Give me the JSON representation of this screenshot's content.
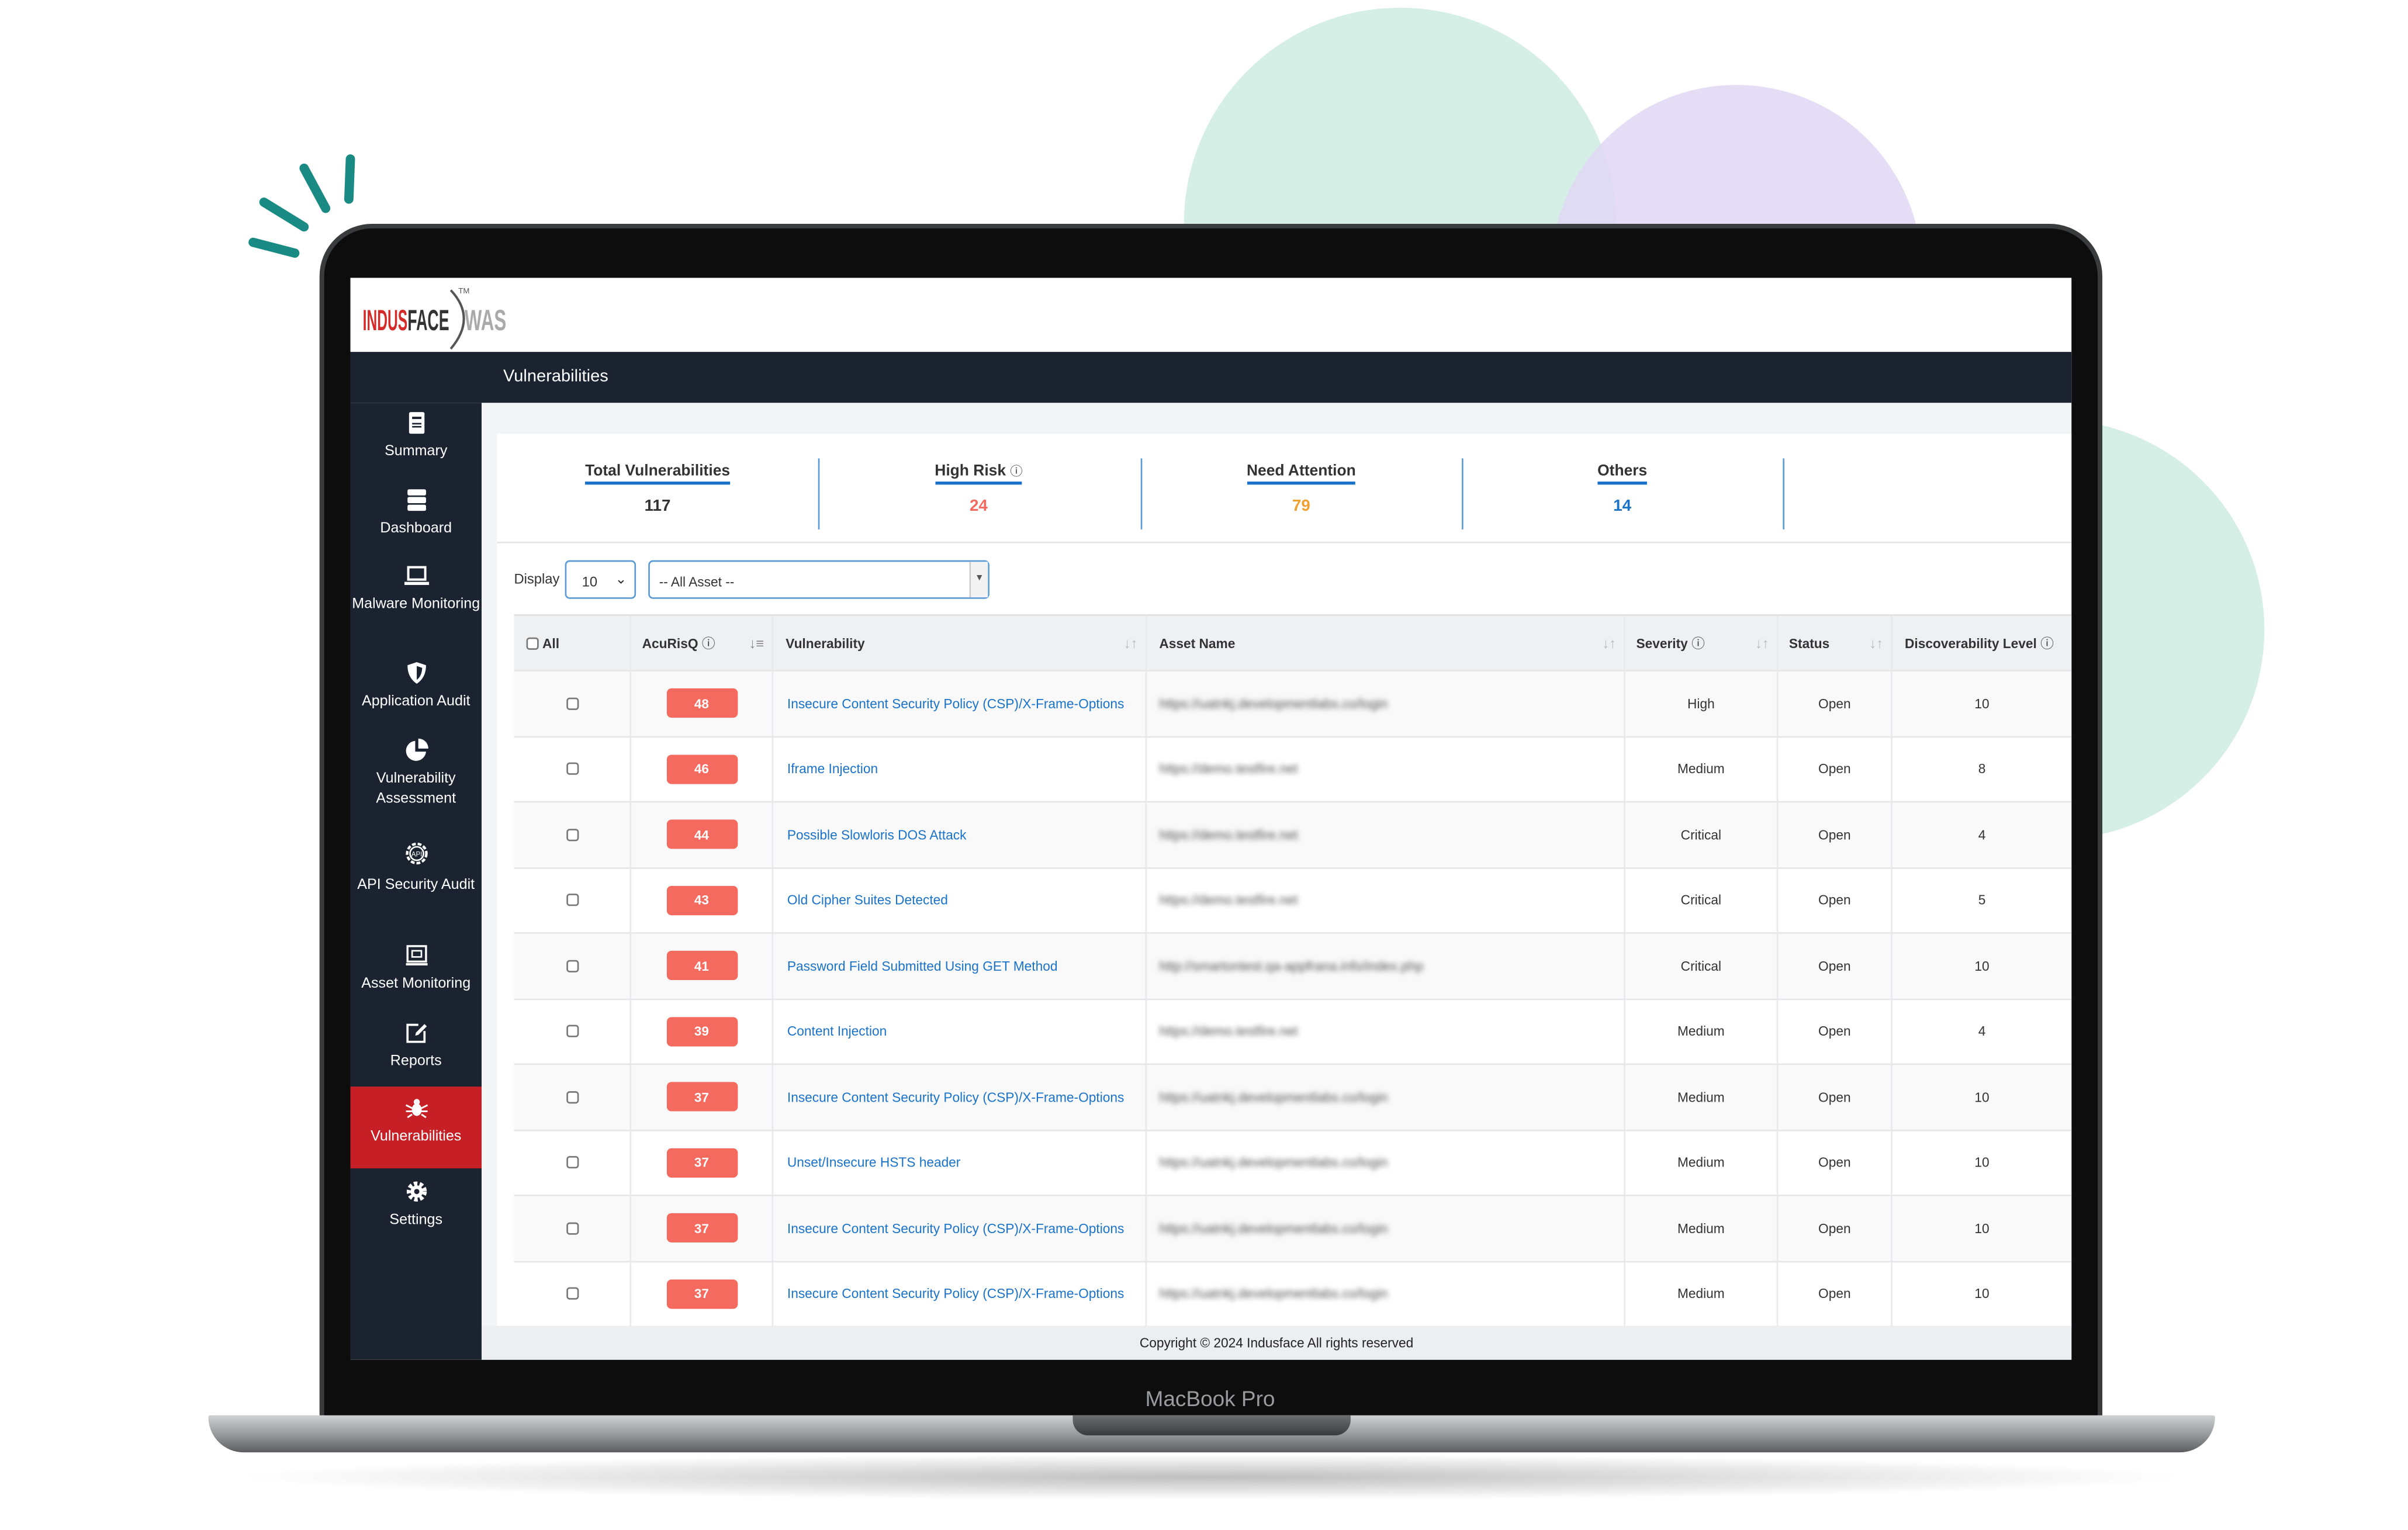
{
  "logo": {
    "brand": "INDUSFACE",
    "product": "WAS",
    "tm": "TM"
  },
  "header": {
    "title": "Vulnerabilities"
  },
  "device_label": "MacBook Pro",
  "sidebar": {
    "items": [
      {
        "label": "Summary",
        "icon": "summary-icon"
      },
      {
        "label": "Dashboard",
        "icon": "server-icon"
      },
      {
        "label": "Malware Monitoring",
        "icon": "laptop-icon"
      },
      {
        "label": "Application Audit",
        "icon": "shield-icon"
      },
      {
        "label": "Vulnerability Assessment",
        "icon": "pie-chart-icon"
      },
      {
        "label": "API Security Audit",
        "icon": "api-gear-icon"
      },
      {
        "label": "Asset Monitoring",
        "icon": "asset-monitor-icon"
      },
      {
        "label": "Reports",
        "icon": "edit-icon"
      },
      {
        "label": "Vulnerabilities",
        "icon": "bug-icon",
        "active": true
      },
      {
        "label": "Settings",
        "icon": "gear-icon"
      }
    ]
  },
  "stats": [
    {
      "label": "Total Vulnerabilities",
      "value": "117",
      "color": "#333333"
    },
    {
      "label": "High Risk",
      "value": "24",
      "color": "#f46a5e",
      "info": true
    },
    {
      "label": "Need Attention",
      "value": "79",
      "color": "#f0a030"
    },
    {
      "label": "Others",
      "value": "14",
      "color": "#1a73c9"
    }
  ],
  "filters": {
    "display_label": "Display",
    "display_value": "10",
    "asset_value": "-- All Asset --"
  },
  "table": {
    "headers": {
      "all": "All",
      "acurisq": "AcuRisQ",
      "vulnerability": "Vulnerability",
      "asset": "Asset Name",
      "severity": "Severity",
      "status": "Status",
      "discoverability": "Discoverability Level"
    },
    "rows": [
      {
        "score": "48",
        "vuln": "Insecure Content Security Policy (CSP)/X-Frame-Options",
        "asset": "https://uatnkj.developmentlabs.co/login",
        "severity": "High",
        "status": "Open",
        "level": "10"
      },
      {
        "score": "46",
        "vuln": "Iframe Injection",
        "asset": "https://demo.testfire.net",
        "severity": "Medium",
        "status": "Open",
        "level": "8"
      },
      {
        "score": "44",
        "vuln": "Possible Slowloris DOS Attack",
        "asset": "https://demo.testfire.net",
        "severity": "Critical",
        "status": "Open",
        "level": "4"
      },
      {
        "score": "43",
        "vuln": "Old Cipher Suites Detected",
        "asset": "https://demo.testfire.net",
        "severity": "Critical",
        "status": "Open",
        "level": "5"
      },
      {
        "score": "41",
        "vuln": "Password Field Submitted Using GET Method",
        "asset": "http://smartontest.qa-appfrana.info/index.php",
        "severity": "Critical",
        "status": "Open",
        "level": "10"
      },
      {
        "score": "39",
        "vuln": "Content Injection",
        "asset": "https://demo.testfire.net",
        "severity": "Medium",
        "status": "Open",
        "level": "4"
      },
      {
        "score": "37",
        "vuln": "Insecure Content Security Policy (CSP)/X-Frame-Options",
        "asset": "https://uatnkj.developmentlabs.co/login",
        "severity": "Medium",
        "status": "Open",
        "level": "10"
      },
      {
        "score": "37",
        "vuln": "Unset/Insecure HSTS header",
        "asset": "https://uatnkj.developmentlabs.co/login",
        "severity": "Medium",
        "status": "Open",
        "level": "10"
      },
      {
        "score": "37",
        "vuln": "Insecure Content Security Policy (CSP)/X-Frame-Options",
        "asset": "https://uatnkj.developmentlabs.co/login",
        "severity": "Medium",
        "status": "Open",
        "level": "10"
      },
      {
        "score": "37",
        "vuln": "Insecure Content Security Policy (CSP)/X-Frame-Options",
        "asset": "https://uatnkj.developmentlabs.co/login",
        "severity": "Medium",
        "status": "Open",
        "level": "10"
      }
    ]
  },
  "footer": {
    "copyright": "Copyright © 2024 Indusface All rights reserved"
  },
  "colors": {
    "accent": "#c62026",
    "sidebar": "#1b2330",
    "link": "#1a73c9",
    "badge": "#f46a5e"
  }
}
